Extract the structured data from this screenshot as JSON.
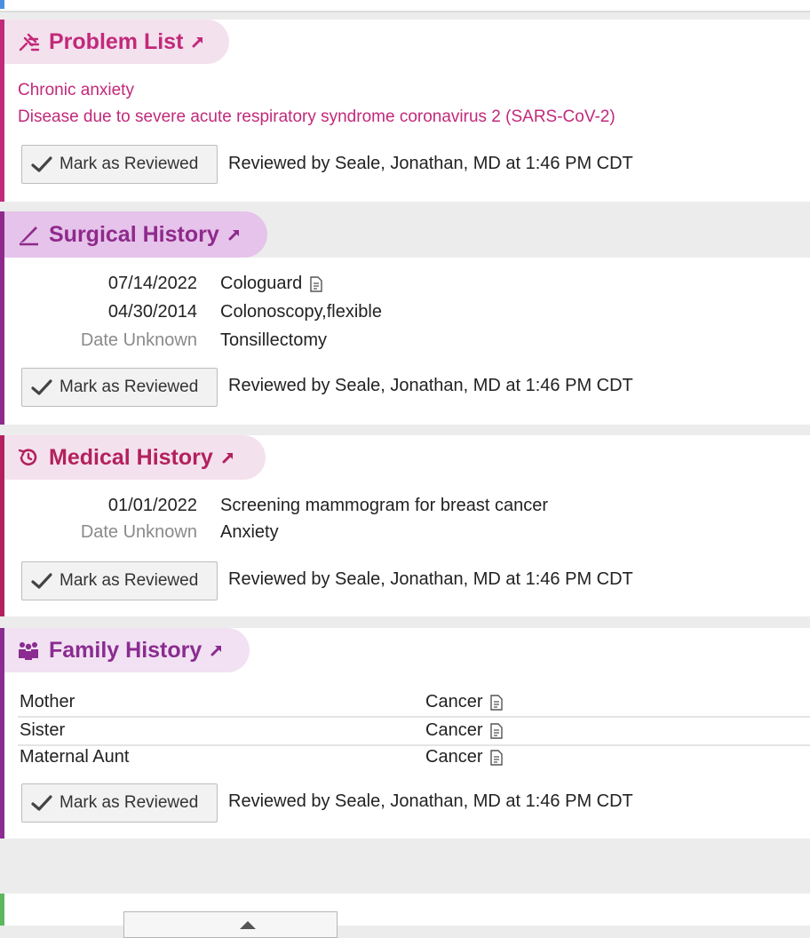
{
  "colors": {
    "problem_accent": "#c2297a",
    "surgical_accent": "#8e2a8c",
    "medical_accent": "#b2215e",
    "family_accent": "#8a2c90",
    "tab_problem_bg": "#f4e1ee",
    "tab_surgical_bg": "#e6c3ea",
    "tab_medical_bg": "#f4e1ee",
    "tab_family_bg": "#f1e1f3"
  },
  "problem_list": {
    "title": "Problem List",
    "icon": "problem-list-icon",
    "items": [
      "Chronic anxiety",
      "Disease due to severe acute respiratory syndrome coronavirus 2 (SARS-CoV-2)"
    ],
    "review_button": "Mark as Reviewed",
    "reviewed_text": "Reviewed by Seale, Jonathan, MD at 1:46 PM CDT"
  },
  "surgical_history": {
    "title": "Surgical History",
    "icon": "scalpel-icon",
    "rows": [
      {
        "date": "07/14/2022",
        "name": "Cologuard",
        "has_note": true
      },
      {
        "date": "04/30/2014",
        "name": "Colonoscopy,flexible",
        "has_note": false
      },
      {
        "date": "Date Unknown",
        "name": "Tonsillectomy",
        "has_note": false
      }
    ],
    "review_button": "Mark as Reviewed",
    "reviewed_text": "Reviewed by Seale, Jonathan, MD at 1:46 PM CDT"
  },
  "medical_history": {
    "title": "Medical History",
    "icon": "history-clock-icon",
    "rows": [
      {
        "date": "01/01/2022",
        "name": "Screening mammogram for breast cancer"
      },
      {
        "date": "Date Unknown",
        "name": "Anxiety"
      }
    ],
    "review_button": "Mark as Reviewed",
    "reviewed_text": "Reviewed by Seale, Jonathan, MD at 1:46 PM CDT"
  },
  "family_history": {
    "title": "Family History",
    "icon": "family-icon",
    "rows": [
      {
        "relation": "Mother",
        "condition": "Cancer"
      },
      {
        "relation": "Sister",
        "condition": "Cancer"
      },
      {
        "relation": "Maternal Aunt",
        "condition": "Cancer"
      }
    ],
    "review_button": "Mark as Reviewed",
    "reviewed_text": "Reviewed by Seale, Jonathan, MD at 1:46 PM CDT"
  }
}
